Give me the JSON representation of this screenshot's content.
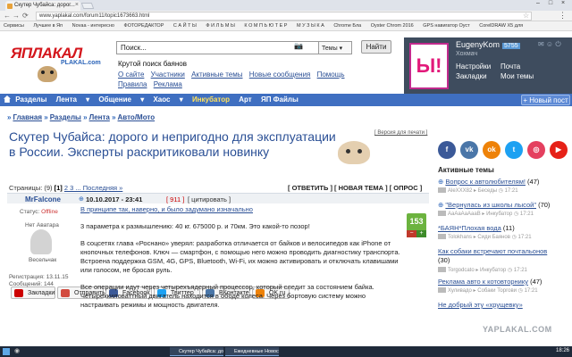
{
  "browser": {
    "tab_title": "Скутер Чубайса: дорог...",
    "url": "www.yaplakal.com/forum11/topic1673663.html",
    "bookmarks": [
      "Сервисы",
      "Лучшее в Яп",
      "Novaa - интересно",
      "ФОТОРЕДАКТОР",
      "С А Й Т Ы",
      "Ф И Л Ь М Ы",
      "К О М П Ь Ю Т Е Р",
      "М У З Ы К А",
      "Chrome Бла",
      "Oyster Chrom 2016",
      "GPS навигатор Оуст",
      "CorelDRAW X5 для"
    ]
  },
  "header": {
    "logo_main": "ЯПЛАКАЛ",
    "logo_sub": "PLAKAL.com",
    "search_placeholder": "Поиск...",
    "search_scope": "Темы",
    "find_label": "Найти",
    "tagline": "Крутой поиск баянов",
    "links_row1": [
      "О сайте",
      "Участники",
      "Активные темы",
      "Новые сообщения",
      "Помощь"
    ],
    "links_row2": [
      "Правила",
      "Реклама"
    ]
  },
  "user": {
    "avatar_text": "Ы!",
    "name": "EugenyKom",
    "rating": "5755",
    "subtitle": "Хохмач",
    "settings": "Настройки",
    "mail": "Почта",
    "bookmarks": "Закладки",
    "my_themes": "Мои темы"
  },
  "menu": {
    "items": [
      "Разделы",
      "Лента",
      "Общение",
      "Хаос",
      "Инкубатор",
      "Арт",
      "ЯП Файлы"
    ],
    "new_post": "Новый пост"
  },
  "breadcrumb": [
    "Главная",
    "Разделы",
    "Лента",
    "Авто/Мото"
  ],
  "topic": {
    "title": "Скутер Чубайса: дорого и непригодно для эксплуатации в России. Эксперты раскритиковали новинку",
    "print_version": "[ Версия для печати ]",
    "share": [
      "Закладки",
      "Отправить",
      "Facebook",
      "Твиттер",
      "ВКонтакте",
      "OK.ru"
    ],
    "pages_label": "Страницы: (9)",
    "pages_current": "[1]",
    "pages_rest": "2 3 ... Последняя »",
    "actions": "[ ОТВЕТИТЬ ] [ НОВАЯ ТЕМА ] [ ОПРОС ]"
  },
  "post": {
    "author": "MrFalcone",
    "date": "10.10.2017 - 23:41",
    "number": "[ 911 ]",
    "cite": "[ цитировать ]",
    "status_label": "Статус:",
    "status_value": "Offline",
    "no_avatar": "Нет Аватара",
    "rank": "Весельчак",
    "reg": "Регистрация: 13.11.15",
    "messages": "Сообщений: 144",
    "score": "153",
    "paragraphs": [
      "В принципе так, наверно, и было задумано изначально",
      "3 параметра к размышлению: 40 кг. 675000 р. и 70км. Это какой-то позор!",
      "В соцсетях глава «Роснано» уверял: разработка отличается от байков и велосипедов как iPhone от кнопочных телефонов. Ключ — смартфон, с помощью него можно проводить диагностику транспорта. Встроена поддержка GSM, 4G, GPS, Bluetooth, Wi-Fi, их можно активировать и отключать клавишами или голосом, не бросая руль.",
      "Все операции идут через четырехъядерный процессор, который следит за состоянием байка. Четырехкиловаттный двигатель находится в ободе колеса. Через бортовую систему можно настраивать режимы и мощность двигателя."
    ]
  },
  "sidebar": {
    "active_title": "Активные темы",
    "themes": [
      {
        "title": "Вопрос к автолюбителям!",
        "count": "(47)",
        "user": "AleXXX82",
        "section": "Беседы",
        "time": "17:21"
      },
      {
        "title": "\"Вернулась из школы лысой\"",
        "count": "(70)",
        "user": "AaAaAaAaaB",
        "section": "Инкубатор",
        "time": "17:21"
      },
      {
        "title": "*БАЯН*Плохая вода",
        "count": "(11)",
        "user": "Tolokhans",
        "section": "Сиди Баянов",
        "time": "17:21"
      },
      {
        "title": "Как собаки встречают почтальонов",
        "count": "(30)",
        "user": "Torgodcato",
        "section": "Инкубатор",
        "time": "17:21"
      },
      {
        "title": "Реклама авто к котовторнику",
        "count": "(47)",
        "user": "Хуливадо",
        "section": "Собаки Торгови",
        "time": "17:21"
      },
      {
        "title": "Не добрый эту «хрущевку»",
        "count": "",
        "user": "",
        "section": "",
        "time": ""
      }
    ]
  },
  "watermark": "YAPLAKAL.COM",
  "taskbar": {
    "items": [
      "Скутер Чубайса: до...",
      "Ежедневные Новости"
    ],
    "clock": "18:26"
  },
  "colors": {
    "menu_bar": "#3f6fc1",
    "link": "#2a4f95",
    "logo_red": "#d4161c",
    "score_green": "#6cb33f"
  }
}
